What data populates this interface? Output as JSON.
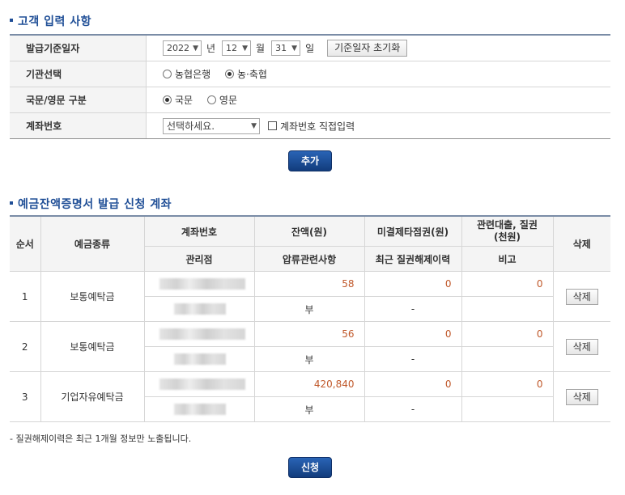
{
  "section1": {
    "title": "고객 입력 사항"
  },
  "form": {
    "issue_date": {
      "label": "발급기준일자",
      "year": "2022",
      "year_unit": "년",
      "month": "12",
      "month_unit": "월",
      "day": "31",
      "day_unit": "일",
      "reset_button": "기준일자 초기화"
    },
    "institution": {
      "label": "기관선택",
      "options": [
        {
          "label": "농협은행",
          "selected": false
        },
        {
          "label": "농·축협",
          "selected": true
        }
      ]
    },
    "language": {
      "label": "국문/영문 구분",
      "options": [
        {
          "label": "국문",
          "selected": true
        },
        {
          "label": "영문",
          "selected": false
        }
      ]
    },
    "account": {
      "label": "계좌번호",
      "select_value": "선택하세요.",
      "direct_input_label": "계좌번호 직접입력"
    },
    "add_button": "추가"
  },
  "section2": {
    "title": "예금잔액증명서 발급 신청 계좌"
  },
  "table": {
    "headers": {
      "order": "순서",
      "type": "예금종류",
      "account_no": "계좌번호",
      "branch": "관리점",
      "balance": "잔액(원)",
      "seizure": "압류관련사항",
      "uncleared": "미결제타점권(원)",
      "pledge_history": "최근 질권해제이력",
      "loan": "관련대출, 질권\n(천원)",
      "remark": "비고",
      "delete": "삭제"
    },
    "rows": [
      {
        "order": "1",
        "type": "보통예탁금",
        "balance": "58",
        "seizure": "부",
        "uncleared": "0",
        "pledge_history": "-",
        "loan": "0",
        "remark": "",
        "delete": "삭제"
      },
      {
        "order": "2",
        "type": "보통예탁금",
        "balance": "56",
        "seizure": "부",
        "uncleared": "0",
        "pledge_history": "-",
        "loan": "0",
        "remark": "",
        "delete": "삭제"
      },
      {
        "order": "3",
        "type": "기업자유예탁금",
        "balance": "420,840",
        "seizure": "부",
        "uncleared": "0",
        "pledge_history": "-",
        "loan": "0",
        "remark": "",
        "delete": "삭제"
      }
    ]
  },
  "note": "- 질권해제이력은 최근 1개월 정보만 노출됩니다.",
  "submit_button": "신청"
}
